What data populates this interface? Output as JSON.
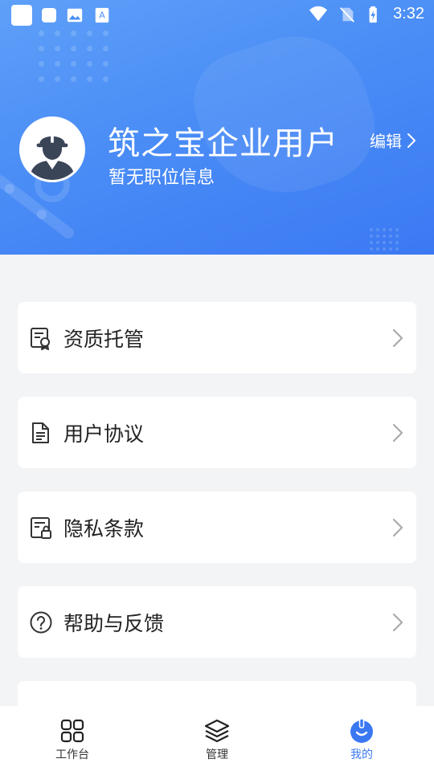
{
  "status_bar": {
    "time": "3:32",
    "left_icons": [
      "app-square-icon",
      "notification-square-icon",
      "image-icon",
      "font-download-icon"
    ],
    "right_icons": [
      "wifi-icon",
      "no-sim-icon",
      "battery-charging-icon"
    ]
  },
  "profile": {
    "name": "筑之宝企业用户",
    "subtitle": "暂无职位信息",
    "edit_label": "编辑",
    "avatar_icon": "worker-helmet-avatar-icon"
  },
  "menu": {
    "items": [
      {
        "label": "资质托管",
        "icon": "certificate-icon"
      },
      {
        "label": "用户协议",
        "icon": "document-icon"
      },
      {
        "label": "隐私条款",
        "icon": "privacy-lock-icon"
      },
      {
        "label": "帮助与反馈",
        "icon": "help-question-icon"
      }
    ]
  },
  "tabbar": {
    "tabs": [
      {
        "label": "工作台",
        "icon": "grid-icon",
        "active": false
      },
      {
        "label": "管理",
        "icon": "layers-icon",
        "active": false
      },
      {
        "label": "我的",
        "icon": "helmet-icon",
        "active": true
      }
    ]
  },
  "colors": {
    "header_gradient_start": "#5ea0f8",
    "header_gradient_end": "#3b79f3",
    "accent": "#3a78f2",
    "background": "#f3f4f6",
    "card": "#ffffff"
  }
}
